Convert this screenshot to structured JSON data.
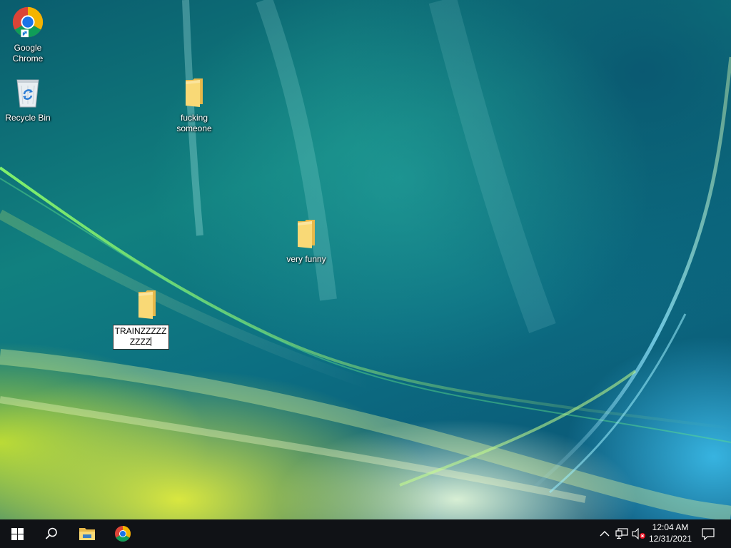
{
  "desktop": {
    "icons": [
      {
        "label": "Google\nChrome"
      },
      {
        "label": "Recycle Bin"
      },
      {
        "label": "fucking\nsomeone"
      },
      {
        "label": "very funny"
      },
      {
        "label": "TRAINZZZZZZZZZ",
        "renaming": true
      }
    ]
  },
  "taskbar": {
    "start_icon": "windows-logo-icon",
    "search_icon": "search-icon",
    "pinned": [
      "file-explorer-icon",
      "chrome-icon"
    ]
  },
  "tray": {
    "icons": [
      "chevron-up-icon",
      "network-icon",
      "volume-muted-icon",
      "notification-icon"
    ],
    "time": "12:04 AM",
    "date": "12/31/2021"
  },
  "colors": {
    "taskbar": "#101216",
    "folder": "#f7d56e",
    "accent_blue": "#1e7fd8"
  }
}
